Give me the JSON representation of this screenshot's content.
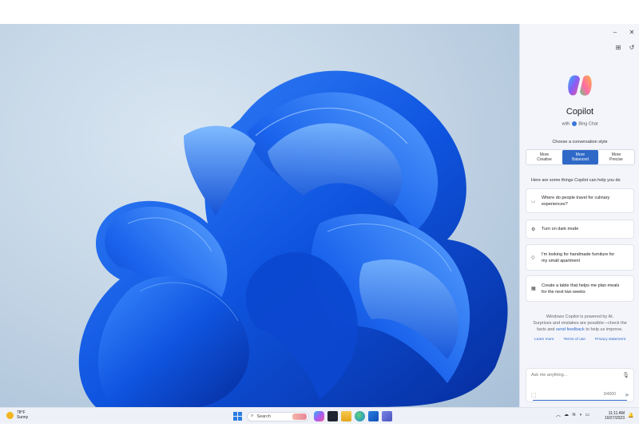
{
  "copilot": {
    "title": "Copilot",
    "subtitle_prefix": "with",
    "subtitle_service": "Bing Chat",
    "choose_style": "Choose a conversation style",
    "styles": [
      {
        "line1": "More",
        "line2": "Creative",
        "active": false
      },
      {
        "line1": "More",
        "line2": "Balanced",
        "active": true
      },
      {
        "line1": "More",
        "line2": "Precise",
        "active": false
      }
    ],
    "help_title": "Here are some things Copilot can help you do",
    "suggestions": [
      {
        "icon": "food-icon",
        "line1": "Where do people travel for culinary",
        "line2": "experiences?"
      },
      {
        "icon": "settings-toggle-icon",
        "line1": "Turn on dark mode",
        "line2": ""
      },
      {
        "icon": "tag-icon",
        "line1": "I'm looking for handmade furniture for",
        "line2": "my small apartment"
      },
      {
        "icon": "table-icon",
        "line1": "Create a table that helps me plan meals",
        "line2": "for the next two weeks"
      }
    ],
    "notice_line1": "Windows Copilot is powered by AI.",
    "notice_line2": "Surprises and mistakes are possible—check the",
    "notice_line3_a": "facts and",
    "notice_line3_link": "send feedback",
    "notice_line3_b": "to help us improve.",
    "links": [
      "Learn more",
      "Terms of use",
      "Privacy statement"
    ],
    "input_placeholder": "Ask me anything...",
    "char_count": "0/4000",
    "accent_color": "#2f69c8"
  },
  "taskbar": {
    "weather_temp": "78°F",
    "weather_desc": "Sunny",
    "search_label": "Search",
    "time": "11:11 AM",
    "date": "10/27/2023"
  }
}
